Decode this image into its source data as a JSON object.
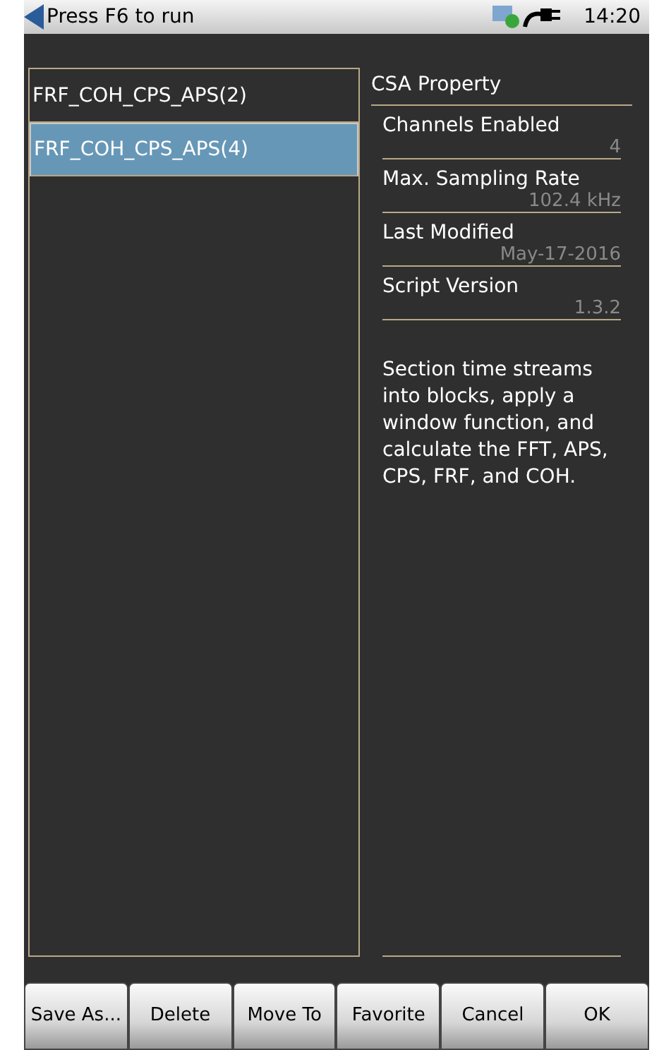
{
  "status_bar": {
    "title": "Press F6 to run",
    "time": "14:20"
  },
  "scripts": [
    {
      "name": "FRF_COH_CPS_APS(2)",
      "selected": false
    },
    {
      "name": "FRF_COH_CPS_APS(4)",
      "selected": true
    }
  ],
  "property_panel": {
    "title": "CSA Property",
    "properties": [
      {
        "label": "Channels Enabled",
        "value": "4"
      },
      {
        "label": "Max. Sampling Rate",
        "value": "102.4 kHz"
      },
      {
        "label": "Last Modified",
        "value": "May-17-2016"
      },
      {
        "label": "Script Version",
        "value": "1.3.2"
      }
    ],
    "description": "Section time streams into blocks, apply a window function, and calculate the FFT, APS, CPS, FRF, and COH."
  },
  "buttons": [
    "Save As...",
    "Delete",
    "Move To",
    "Favorite",
    "Cancel",
    "OK"
  ]
}
